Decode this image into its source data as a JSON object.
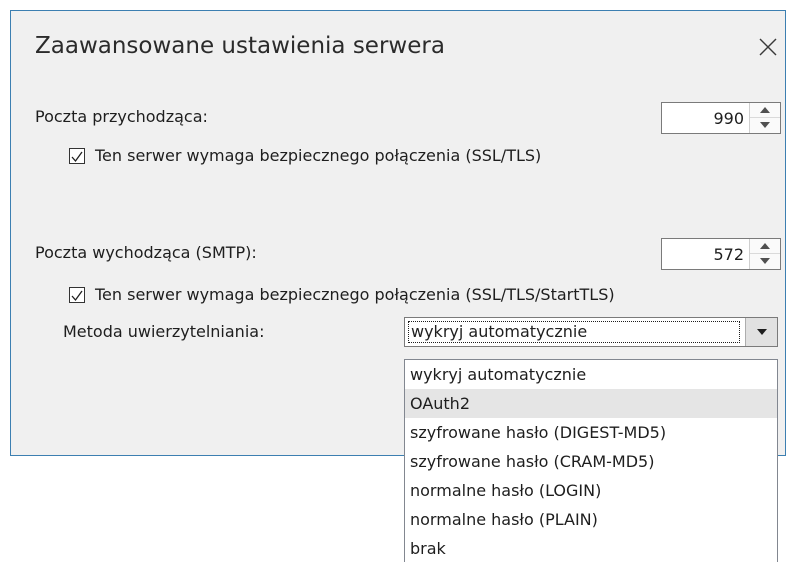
{
  "dialog": {
    "title": "Zaawansowane ustawienia serwera",
    "close_icon": "close-icon"
  },
  "incoming": {
    "label": "Poczta przychodząca:",
    "port": "990",
    "ssl_checkbox_checked": true,
    "ssl_label": "Ten serwer wymaga bezpiecznego połączenia (SSL/TLS)"
  },
  "outgoing": {
    "label": "Poczta wychodząca (SMTP):",
    "port": "572",
    "ssl_checkbox_checked": true,
    "ssl_label": "Ten serwer wymaga bezpiecznego połączenia (SSL/TLS/StartTLS)"
  },
  "auth": {
    "label": "Metoda uwierzytelniania:",
    "selected": "wykryj automatycznie",
    "options": [
      "wykryj automatycznie",
      "OAuth2",
      "szyfrowane hasło (DIGEST-MD5)",
      "szyfrowane hasło (CRAM-MD5)",
      "normalne hasło (LOGIN)",
      "normalne hasło (PLAIN)",
      "brak"
    ],
    "highlighted_option": "OAuth2"
  },
  "colors": {
    "dialog_bg": "#f0f0f0",
    "dialog_border": "#3c7fb1",
    "hover_bg": "#e5e5e5"
  }
}
